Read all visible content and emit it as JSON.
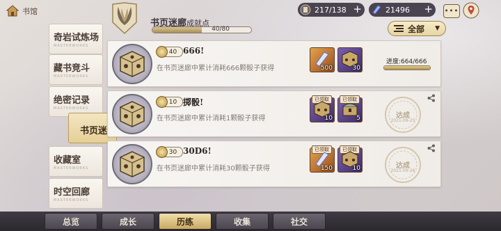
{
  "header": {
    "home_label": "书馆",
    "title": "书页迷廊",
    "title_suffix": "成就点",
    "progress_text": "40/80",
    "progress_fraction": 0.5
  },
  "resources": [
    {
      "icon": "stamina-icon",
      "value": "217/138"
    },
    {
      "icon": "crystal-icon",
      "value": "21496"
    }
  ],
  "filter": {
    "label": "全部"
  },
  "sidebar": {
    "items": [
      {
        "label": "奇岩试炼场",
        "sub": "MASTERWORKS"
      },
      {
        "label": "藏书竞斗",
        "sub": "MASTERWORKS"
      },
      {
        "label": "绝密记录",
        "sub": "MASTERWORKS"
      },
      {
        "label": "书页迷廊",
        "sub": "MASTERWORKS"
      },
      {
        "label": "收藏室",
        "sub": "MASTERWORKS"
      },
      {
        "label": "时空回廊",
        "sub": "MASTERWORKS"
      }
    ]
  },
  "achievements": [
    {
      "points": "40",
      "name": "666!",
      "desc": "在书页迷廊中累计消耗666颗骰子获得",
      "rewards": [
        {
          "type": "crystal",
          "qty": "500",
          "claimed": ""
        },
        {
          "type": "dice",
          "qty": "30",
          "claimed": ""
        }
      ],
      "progress_label": "进度:664/666",
      "progress_fraction": 0.997
    },
    {
      "points": "10",
      "name": "掷骰!",
      "desc": "在书页迷廊中累计消耗1颗骰子获得",
      "rewards": [
        {
          "type": "dice",
          "qty": "10",
          "claimed": "已领取"
        },
        {
          "type": "chest",
          "qty": "5",
          "claimed": "已领取"
        }
      ],
      "stamp_title": "达成",
      "stamp_date": "2021-09-25"
    },
    {
      "points": "30",
      "name": "30D6!",
      "desc": "在书页迷廊中累计消耗30颗骰子获得",
      "rewards": [
        {
          "type": "crystal",
          "qty": "150",
          "claimed": "已领取"
        },
        {
          "type": "dice",
          "qty": "10",
          "claimed": "已领取"
        }
      ],
      "stamp_title": "达成",
      "stamp_date": "2021-09-26"
    }
  ],
  "tabs": [
    {
      "label": "总览"
    },
    {
      "label": "成长"
    },
    {
      "label": "历练"
    },
    {
      "label": "收集"
    },
    {
      "label": "社交"
    }
  ],
  "active_tab": 2,
  "colors": {
    "accent_gold": "#c9a863",
    "dark_bar": "#2b282e",
    "purple_frame": "#3f2e69",
    "orange_frame": "#9a4e1d"
  }
}
